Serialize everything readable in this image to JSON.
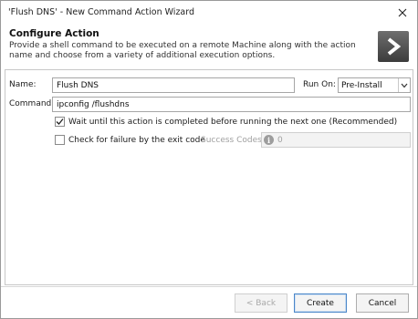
{
  "window": {
    "title": "'Flush DNS' - New Command Action Wizard"
  },
  "header": {
    "title": "Configure Action",
    "description": "Provide a shell command to be executed on a remote Machine along with the action name and choose from a variety of additional execution options."
  },
  "form": {
    "name_label": "Name:",
    "name_value": "Flush DNS",
    "run_on_label": "Run On:",
    "run_on_value": "Pre-Install",
    "command_label": "Command:",
    "command_value": "ipconfig /flushdns",
    "wait_label": "Wait until this action is completed before running the next one (Recommended)",
    "wait_checked": true,
    "failure_label": "Check for failure by the exit code",
    "failure_checked": false,
    "success_codes_label": "Success Codes:",
    "success_codes_value": "0"
  },
  "buttons": {
    "back": "< Back",
    "create": "Create",
    "cancel": "Cancel"
  },
  "colors": {
    "accent": "#4a86c8",
    "logo_bg": "#4f4f4f"
  }
}
